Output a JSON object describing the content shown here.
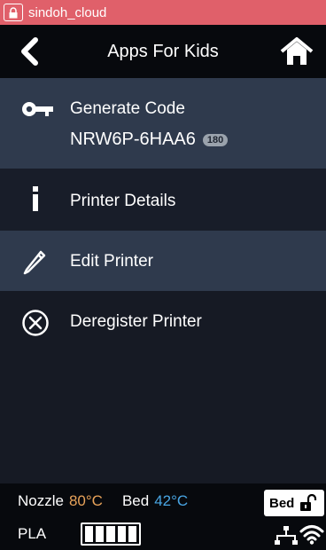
{
  "statusbar": {
    "title": "sindoh_cloud",
    "icon": "lock-screen-icon"
  },
  "header": {
    "title": "Apps For Kids",
    "back_icon": "chevron-left-icon",
    "home_icon": "home-icon"
  },
  "menu": {
    "generate_code": {
      "label": "Generate Code",
      "code": "NRW6P-6HAA6",
      "timer": "180",
      "icon": "key-icon"
    },
    "printer_details": {
      "label": "Printer Details",
      "icon": "info-icon"
    },
    "edit_printer": {
      "label": "Edit Printer",
      "icon": "pencil-icon"
    },
    "deregister_printer": {
      "label": "Deregister Printer",
      "icon": "circle-x-icon"
    }
  },
  "footer": {
    "nozzle_label": "Nozzle",
    "nozzle_temp": "80°C",
    "bed_label": "Bed",
    "bed_temp": "42°C",
    "material": "PLA",
    "filament_level": 1.0,
    "bed_lock_label": "Bed",
    "bed_lock_icon": "unlocked-padlock-icon",
    "network_icons": [
      "ethernet-icon",
      "wifi-icon"
    ]
  },
  "colors": {
    "statusbar": "#e0606a",
    "selected_row": "#2f3a4d",
    "nozzle": "#e8a35a",
    "bed": "#49a6e4"
  }
}
